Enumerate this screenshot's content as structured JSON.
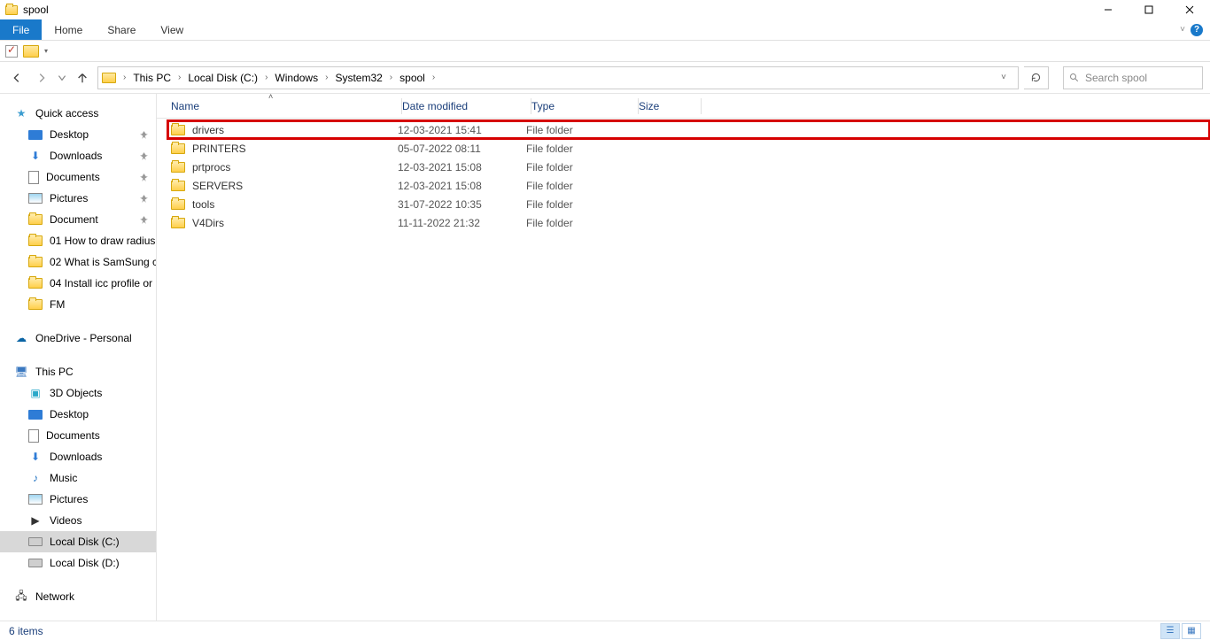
{
  "window": {
    "title": "spool"
  },
  "ribbon": {
    "tabs": [
      "File",
      "Home",
      "Share",
      "View"
    ]
  },
  "breadcrumb": [
    "This PC",
    "Local Disk (C:)",
    "Windows",
    "System32",
    "spool"
  ],
  "search": {
    "placeholder": "Search spool"
  },
  "sidebar": {
    "quick": {
      "label": "Quick access",
      "items": [
        {
          "label": "Desktop",
          "pin": true,
          "icon": "desktop"
        },
        {
          "label": "Downloads",
          "pin": true,
          "icon": "down"
        },
        {
          "label": "Documents",
          "pin": true,
          "icon": "doc"
        },
        {
          "label": "Pictures",
          "pin": true,
          "icon": "pic"
        },
        {
          "label": "Document",
          "pin": true,
          "icon": "folder"
        },
        {
          "label": "01 How to draw radius",
          "icon": "folder"
        },
        {
          "label": "02 What is SamSung c",
          "icon": "folder"
        },
        {
          "label": "04 Install icc profile or",
          "icon": "folder"
        },
        {
          "label": "FM",
          "icon": "folder"
        }
      ]
    },
    "onedrive": {
      "label": "OneDrive - Personal"
    },
    "thispc": {
      "label": "This PC",
      "items": [
        {
          "label": "3D Objects",
          "icon": "3d"
        },
        {
          "label": "Desktop",
          "icon": "desktop"
        },
        {
          "label": "Documents",
          "icon": "doc"
        },
        {
          "label": "Downloads",
          "icon": "down"
        },
        {
          "label": "Music",
          "icon": "music"
        },
        {
          "label": "Pictures",
          "icon": "pic"
        },
        {
          "label": "Videos",
          "icon": "video"
        },
        {
          "label": "Local Disk (C:)",
          "icon": "disk",
          "selected": true
        },
        {
          "label": "Local Disk (D:)",
          "icon": "disk"
        }
      ]
    },
    "network": {
      "label": "Network"
    }
  },
  "columns": {
    "name": "Name",
    "date": "Date modified",
    "type": "Type",
    "size": "Size"
  },
  "rows": [
    {
      "name": "drivers",
      "date": "12-03-2021 15:41",
      "type": "File folder",
      "highlight": true
    },
    {
      "name": "PRINTERS",
      "date": "05-07-2022 08:11",
      "type": "File folder"
    },
    {
      "name": "prtprocs",
      "date": "12-03-2021 15:08",
      "type": "File folder"
    },
    {
      "name": "SERVERS",
      "date": "12-03-2021 15:08",
      "type": "File folder"
    },
    {
      "name": "tools",
      "date": "31-07-2022 10:35",
      "type": "File folder"
    },
    {
      "name": "V4Dirs",
      "date": "11-11-2022 21:32",
      "type": "File folder"
    }
  ],
  "status": {
    "text": "6 items"
  }
}
